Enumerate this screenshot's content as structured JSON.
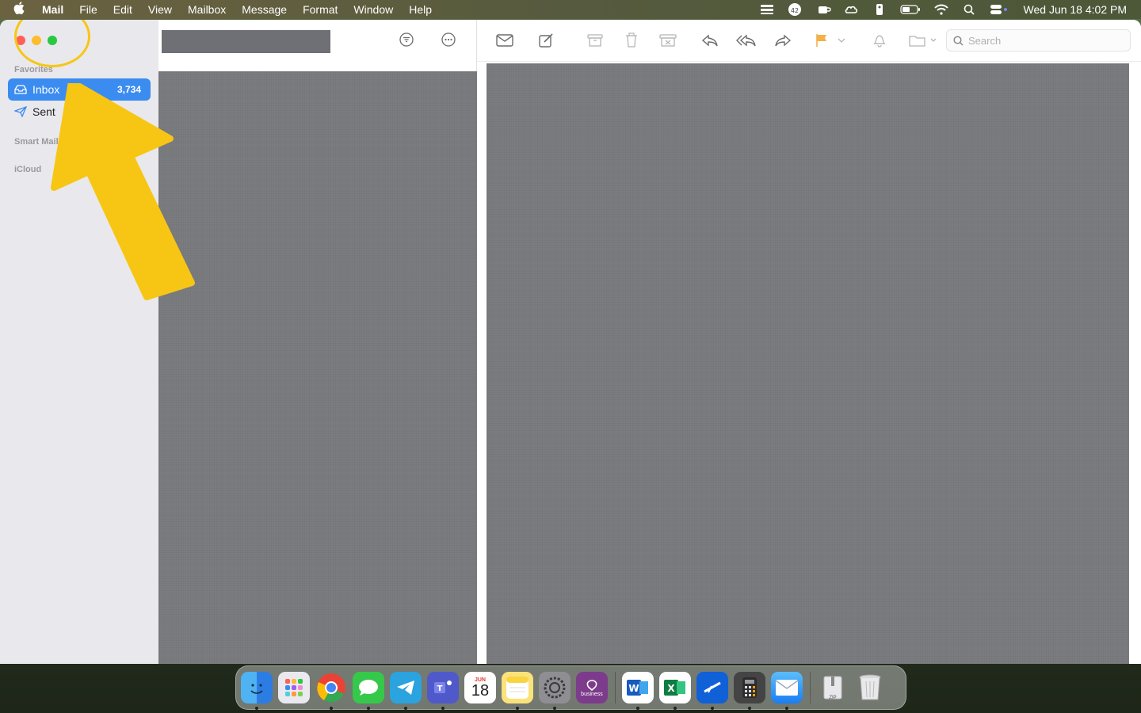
{
  "menubar": {
    "apple_icon": "apple-logo-icon",
    "app_name": "Mail",
    "items": [
      "File",
      "Edit",
      "View",
      "Mailbox",
      "Message",
      "Format",
      "Window",
      "Help"
    ],
    "status_icons": [
      "stacks-icon",
      "badge-42-icon",
      "coffee-icon",
      "creative-cloud-icon",
      "remote-icon",
      "battery-icon",
      "wifi-icon",
      "search-icon",
      "control-center-icon"
    ],
    "badge_count": "42",
    "clock": "Wed Jun 18  4:02 PM"
  },
  "sidebar": {
    "favorites_label": "Favorites",
    "items": [
      {
        "label": "Inbox",
        "count": "3,734",
        "icon": "inbox-icon"
      },
      {
        "label": "Sent",
        "count": "",
        "icon": "paper-plane-icon"
      }
    ],
    "smart_mailboxes_label": "Smart Mailboxes",
    "icloud_label": "iCloud"
  },
  "list": {
    "filter_icon": "filter-icon",
    "more_icon": "more-options-icon"
  },
  "toolbar": {
    "icons": [
      "get-mail-icon",
      "compose-icon",
      "archive-icon",
      "trash-icon",
      "junk-icon",
      "reply-icon",
      "reply-all-icon",
      "forward-icon",
      "flag-icon",
      "flag-menu-icon",
      "notify-icon",
      "move-icon"
    ],
    "search_placeholder": "Search"
  },
  "dock": {
    "apps": [
      "Finder",
      "Launchpad",
      "Chrome",
      "Messages",
      "Telegram",
      "Teams",
      "Calendar",
      "Notes",
      "System Settings",
      "Viber",
      "Word",
      "Excel",
      "Mail Helper",
      "Calculator",
      "Mail",
      "Archive",
      "Trash"
    ],
    "calendar_month": "JUN",
    "calendar_day": "18",
    "viber_sublabel": "business",
    "archive_label": "ZIP"
  },
  "colors": {
    "accent": "#3b8cf0",
    "annotation": "#f7c614",
    "flag": "#f6b04a"
  }
}
